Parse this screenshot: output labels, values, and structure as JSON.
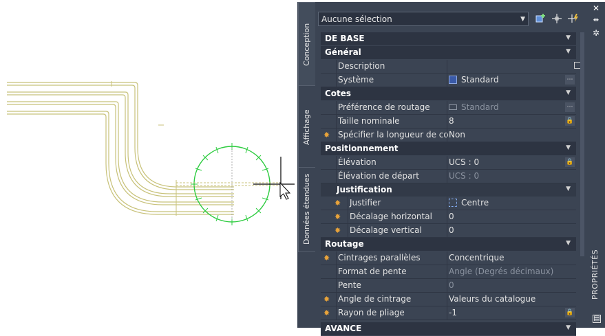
{
  "palette": {
    "title": "PROPRIÉTÉS",
    "tabs": [
      {
        "label": "Conception"
      },
      {
        "label": "Affichage"
      },
      {
        "label": "Données étendues"
      }
    ],
    "selector": {
      "value": "Aucune sélection"
    },
    "toolbar": {
      "icons": [
        "add-selection-icon",
        "pick-point-icon",
        "quick-select-icon"
      ]
    },
    "window_buttons": {
      "icons": [
        "close-icon",
        "autohide-icon",
        "options-icon"
      ]
    },
    "sections": {
      "base": {
        "title": "DE BASE"
      },
      "general": {
        "title": "Général",
        "description": {
          "label": "Description"
        },
        "system": {
          "label": "Système",
          "value": "Standard"
        }
      },
      "cotes": {
        "title": "Cotes",
        "routing_pref": {
          "label": "Préférence de routage",
          "value": "Standard"
        },
        "nominal_size": {
          "label": "Taille nominale",
          "value": "8"
        },
        "specify_length": {
          "label": "Spécifier la longueur de co...",
          "value": "Non"
        }
      },
      "positionnement": {
        "title": "Positionnement",
        "elevation": {
          "label": "Élévation",
          "value": "UCS : 0"
        },
        "start_elevation": {
          "label": "Élévation de départ",
          "value": "UCS : 0"
        }
      },
      "justification": {
        "title": "Justification",
        "justify": {
          "label": "Justifier",
          "value": "Centre"
        },
        "h_offset": {
          "label": "Décalage horizontal",
          "value": "0"
        },
        "v_offset": {
          "label": "Décalage vertical",
          "value": "0"
        }
      },
      "routage": {
        "title": "Routage",
        "parallel_bends": {
          "label": "Cintrages parallèles",
          "value": "Concentrique"
        },
        "slope_format": {
          "label": "Format de pente",
          "value": "Angle (Degrés décimaux)"
        },
        "slope": {
          "label": "Pente",
          "value": "0"
        },
        "bend_angle": {
          "label": "Angle de cintrage",
          "value": "Valeurs du catalogue"
        },
        "bend_radius": {
          "label": "Rayon de pliage",
          "value": "-1"
        }
      },
      "advanced": {
        "title": "AVANCE"
      }
    },
    "colors": {
      "panel": "#3b4453",
      "header": "#2d3442",
      "modified_star": "#e8a33a",
      "pipe": "#c8c27a",
      "grip_circle": "#2ecc40"
    }
  }
}
